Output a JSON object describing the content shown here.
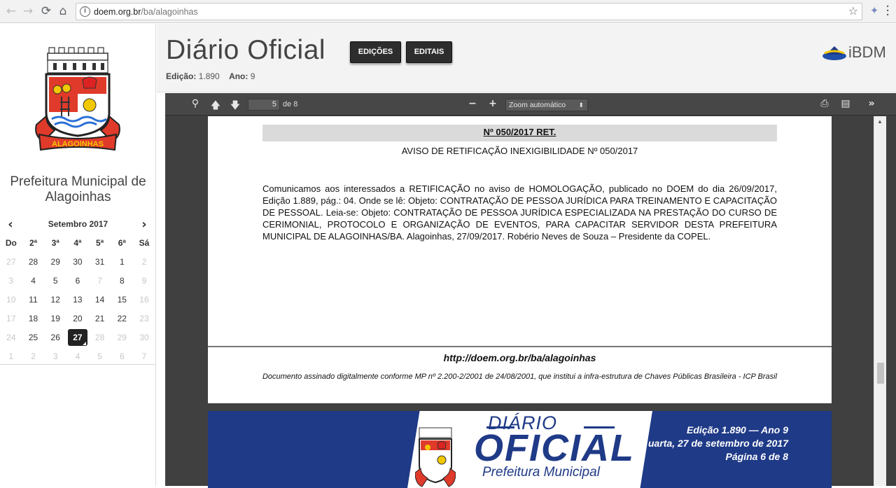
{
  "browser": {
    "url_host": "doem.org.br",
    "url_path": "/ba/alagoinhas"
  },
  "sidebar": {
    "crest_banner_text": "ALAGOINHAS",
    "city_name": "Prefeitura Municipal de Alagoinhas",
    "calendar": {
      "title": "Setembro 2017",
      "weekdays": [
        "Do",
        "2ª",
        "3ª",
        "4ª",
        "5ª",
        "6ª",
        "Sá"
      ],
      "weeks": [
        [
          {
            "d": "27",
            "m": true
          },
          {
            "d": "28",
            "m": false
          },
          {
            "d": "29",
            "m": false
          },
          {
            "d": "30",
            "m": false
          },
          {
            "d": "31",
            "m": false
          },
          {
            "d": "1",
            "m": false
          },
          {
            "d": "2",
            "m": true
          }
        ],
        [
          {
            "d": "3",
            "m": true
          },
          {
            "d": "4",
            "m": false
          },
          {
            "d": "5",
            "m": false
          },
          {
            "d": "6",
            "m": false
          },
          {
            "d": "7",
            "m": true
          },
          {
            "d": "8",
            "m": false
          },
          {
            "d": "9",
            "m": true
          }
        ],
        [
          {
            "d": "10",
            "m": true
          },
          {
            "d": "11",
            "m": false
          },
          {
            "d": "12",
            "m": false
          },
          {
            "d": "13",
            "m": false
          },
          {
            "d": "14",
            "m": false
          },
          {
            "d": "15",
            "m": false
          },
          {
            "d": "16",
            "m": true
          }
        ],
        [
          {
            "d": "17",
            "m": true
          },
          {
            "d": "18",
            "m": false
          },
          {
            "d": "19",
            "m": false
          },
          {
            "d": "20",
            "m": false
          },
          {
            "d": "21",
            "m": false
          },
          {
            "d": "22",
            "m": false
          },
          {
            "d": "23",
            "m": true
          }
        ],
        [
          {
            "d": "24",
            "m": true
          },
          {
            "d": "25",
            "m": false
          },
          {
            "d": "26",
            "m": false
          },
          {
            "d": "27",
            "m": false,
            "today": true
          },
          {
            "d": "28",
            "m": true
          },
          {
            "d": "29",
            "m": true
          },
          {
            "d": "30",
            "m": true
          }
        ],
        [
          {
            "d": "1",
            "m": true
          },
          {
            "d": "2",
            "m": true
          },
          {
            "d": "3",
            "m": true
          },
          {
            "d": "4",
            "m": true
          },
          {
            "d": "5",
            "m": true
          },
          {
            "d": "6",
            "m": true
          },
          {
            "d": "7",
            "m": true
          }
        ]
      ]
    }
  },
  "header": {
    "title": "Diário Oficial",
    "buttons": {
      "edicoes": "EDIÇÕES",
      "editais": "EDITAIS"
    },
    "edition_label": "Edição:",
    "edition_value": "1.890",
    "year_label": "Ano:",
    "year_value": "9",
    "brand": "iBDM"
  },
  "viewer": {
    "page_current": "5",
    "page_of": "de 8",
    "zoom": "Zoom automático"
  },
  "document": {
    "number": "Nº 050/2017 RET.",
    "subtitle": "AVISO DE RETIFICAÇÃO INEXIGIBILIDADE Nº 050/2017",
    "body": "Comunicamos aos interessados a RETIFICAÇÃO no aviso de HOMOLOGAÇÃO, publicado no DOEM do dia 26/09/2017, Edição 1.889, pág.: 04. Onde se lê: Objeto: CONTRATAÇÃO DE PESSOA JURÍDICA PARA TREINAMENTO E CAPACITAÇÃO DE PESSOAL. Leia-se: Objeto: CONTRATAÇÃO DE PESSOA JURÍDICA ESPECIALIZADA NA PRESTAÇÃO DO CURSO DE CERIMONIAL, PROTOCOLO E ORGANIZAÇÃO DE EVENTOS, PARA CAPACITAR SERVIDOR DESTA PREFEITURA MUNICIPAL DE ALAGOINHAS/BA. Alagoinhas, 27/09/2017. Robério Neves de Souza – Presidente da COPEL.",
    "footer_url": "http://doem.org.br/ba/alagoinhas",
    "footer_signed": "Documento assinado digitalmente conforme MP nº 2.200-2/2001 de 24/08/2001, que institui a infra-estrutura de Chaves Públicas Brasileira - ICP Brasil"
  },
  "next_page_banner": {
    "diario": "DIÁRIO",
    "oficial": "OFICIAL",
    "prefeitura": "Prefeitura Municipal",
    "edition_line": "Edição 1.890 — Ano 9",
    "date_line": "uarta, 27 de setembro de 2017",
    "page_line": "Página 6 de 8"
  }
}
